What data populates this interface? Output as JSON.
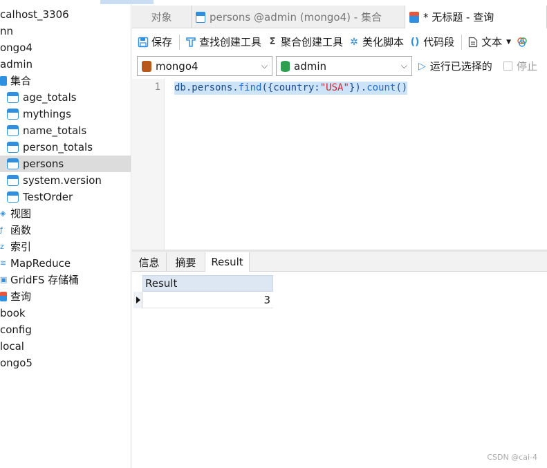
{
  "sidebar": {
    "items": [
      {
        "label": "calhost_3306",
        "icon": "none",
        "level": 0
      },
      {
        "label": "nn",
        "icon": "none",
        "level": 0
      },
      {
        "label": "ongo4",
        "icon": "none",
        "level": 0
      },
      {
        "label": "admin",
        "icon": "none",
        "level": 0
      },
      {
        "label": "集合",
        "icon": "collection-folder-icon",
        "level": 1
      },
      {
        "label": "age_totals",
        "icon": "table-icon",
        "level": 2
      },
      {
        "label": "mythings",
        "icon": "table-icon",
        "level": 2
      },
      {
        "label": "name_totals",
        "icon": "table-icon",
        "level": 2
      },
      {
        "label": "person_totals",
        "icon": "table-icon",
        "level": 2
      },
      {
        "label": "persons",
        "icon": "table-icon",
        "level": 2,
        "selected": true
      },
      {
        "label": "system.version",
        "icon": "table-icon",
        "level": 2
      },
      {
        "label": "TestOrder",
        "icon": "table-icon",
        "level": 2
      },
      {
        "label": "视图",
        "icon": "view-icon",
        "level": 1
      },
      {
        "label": "函数",
        "icon": "function-icon",
        "level": 1
      },
      {
        "label": "索引",
        "icon": "index-icon",
        "level": 1
      },
      {
        "label": "MapReduce",
        "icon": "mapreduce-icon",
        "level": 1
      },
      {
        "label": "GridFS 存储桶",
        "icon": "gridfs-icon",
        "level": 1
      },
      {
        "label": "查询",
        "icon": "query-icon",
        "level": 1
      },
      {
        "label": "book",
        "icon": "none",
        "level": 0
      },
      {
        "label": "config",
        "icon": "none",
        "level": 0
      },
      {
        "label": "local",
        "icon": "none",
        "level": 0
      },
      {
        "label": "ongo5",
        "icon": "none",
        "level": 0
      }
    ]
  },
  "tabs": {
    "objects": "对象",
    "persons": "persons @admin (mongo4) - 集合",
    "query": "* 无标题 - 查询"
  },
  "toolbar": {
    "save": "保存",
    "find_builder": "查找创建工具",
    "aggregate_builder": "聚合创建工具",
    "beautify": "美化脚本",
    "snippet": "代码段",
    "text": "文本"
  },
  "selectors": {
    "connection": "mongo4",
    "database": "admin",
    "run_selected": "运行已选择的",
    "stop": "停止"
  },
  "editor": {
    "line_number": "1",
    "code_tokens": [
      {
        "text": "db.persons.",
        "cls": "tok-plain"
      },
      {
        "text": "find",
        "cls": "tok-fn"
      },
      {
        "text": "({country:",
        "cls": "tok-plain"
      },
      {
        "text": "\"USA\"",
        "cls": "tok-str"
      },
      {
        "text": "}).",
        "cls": "tok-plain"
      },
      {
        "text": "count",
        "cls": "tok-fn"
      },
      {
        "text": "()",
        "cls": "tok-plain"
      }
    ]
  },
  "result_tabs": {
    "info": "信息",
    "summary": "摘要",
    "result": "Result"
  },
  "grid": {
    "header": "Result",
    "rows": [
      "3"
    ]
  },
  "watermark": "CSDN @cai-4",
  "colors": {
    "accent": "#2f8fe0",
    "selection": "#cde3f7",
    "string": "#d8242f"
  }
}
